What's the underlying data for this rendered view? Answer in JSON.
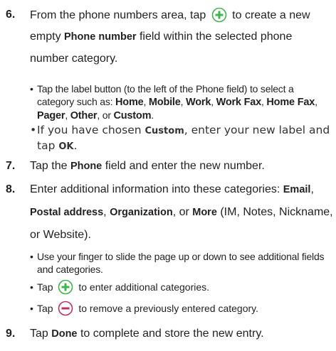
{
  "steps": [
    {
      "num": "6.",
      "line1_pre": "From the phone numbers area, tap",
      "add_icon": "plus-circle-icon",
      "line1_post": "to create a new",
      "line2_pre": "empty ",
      "line2_bold": "Phone number",
      "line2_post": " field within the selected phone",
      "line3": "number category.",
      "bullets": [
        {
          "pre": "Tap the label button (to the left of the Phone field) to select a category such as: ",
          "bold1": "Home",
          "c1": ", ",
          "bold2": "Mobile",
          "c2": ", ",
          "bold3": "Work",
          "c3": ", ",
          "bold4": "Work Fax",
          "c4": ", ",
          "bold5": "Home Fax",
          "c5": ", ",
          "bold6": "Pager",
          "c6": ", ",
          "bold7": "Other",
          "c7": ", or ",
          "bold8": "Custom",
          "c8": "."
        },
        {
          "pre": "If you have chosen ",
          "bold1": "Custom",
          "mid": ", enter your new label and tap ",
          "bold2": "OK",
          "post": "."
        }
      ]
    },
    {
      "num": "7.",
      "pre": "Tap the ",
      "bold": "Phone",
      "post": " field and enter the new number."
    },
    {
      "num": "8.",
      "pre": "Enter additional information into these categories: ",
      "bold1": "Email",
      "c1": ",",
      "bold2": "Postal address",
      "c2": ", ",
      "bold3": "Organization",
      "c3": ", or ",
      "bold4": "More",
      "post": " (IM, Notes, Nickname,",
      "line3": "or Website).",
      "bullets": [
        {
          "text": "Use your finger to slide the page up or down to see additional fields and categories."
        },
        {
          "pre": "Tap",
          "icon": "plus-circle-icon",
          "post": "to enter additional categories."
        },
        {
          "pre": "Tap",
          "icon": "minus-circle-icon",
          "post": "to remove a previously entered category."
        }
      ]
    },
    {
      "num": "9.",
      "pre": "Tap ",
      "bold": "Done",
      "post": " to complete and store the new entry."
    }
  ],
  "colors": {
    "text": "#231f20",
    "plus_icon": "#3db54a",
    "minus_icon": "#c0305a"
  }
}
